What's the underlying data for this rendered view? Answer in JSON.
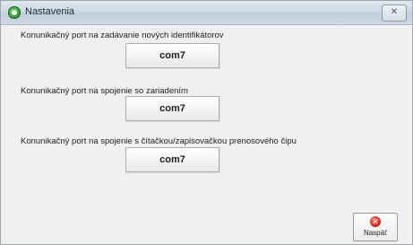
{
  "window": {
    "title": "Nastavenia",
    "close_glyph": "✕"
  },
  "sections": [
    {
      "label": "Konunikačný port na zadávanie nových identifikátorov",
      "port_value": "com7"
    },
    {
      "label": "Konunikačný port na spojenie so zariadením",
      "port_value": "com7"
    },
    {
      "label": "Konunikačný port na spojenie s čítačkou/zapisovačkou prenosového čipu",
      "port_value": "com7"
    }
  ],
  "footer": {
    "back_label": "Naspäť",
    "back_icon": "close-circle-icon",
    "back_glyph": "✕"
  },
  "colors": {
    "window_bg": "#f0f0f0",
    "titlebar": "#cfd9e3",
    "back_icon_red": "#d9281a",
    "app_icon_green": "#2f9b3a"
  }
}
